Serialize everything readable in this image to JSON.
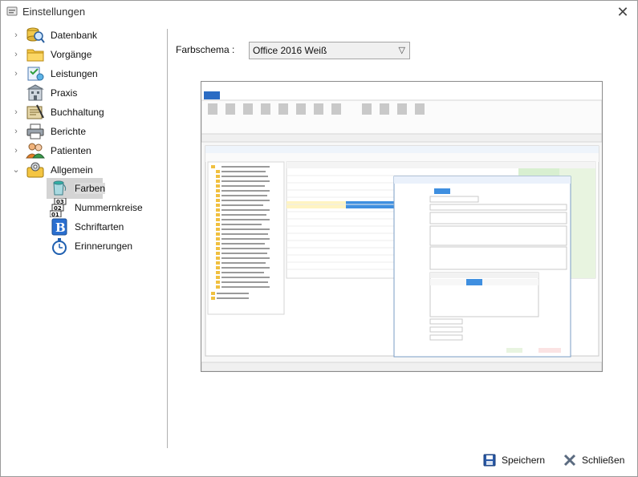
{
  "window": {
    "title": "Einstellungen",
    "close_label": "✕"
  },
  "nav": {
    "items": [
      {
        "label": "Datenbank",
        "icon": "database-search-icon"
      },
      {
        "label": "Vorgänge",
        "icon": "folder-icon"
      },
      {
        "label": "Leistungen",
        "icon": "services-icon"
      },
      {
        "label": "Praxis",
        "icon": "building-icon"
      },
      {
        "label": "Buchhaltung",
        "icon": "accounting-icon"
      },
      {
        "label": "Berichte",
        "icon": "printer-icon"
      },
      {
        "label": "Patienten",
        "icon": "patients-icon"
      },
      {
        "label": "Allgemein",
        "icon": "general-settings-icon"
      }
    ],
    "subitems": [
      {
        "label": "Farben",
        "icon": "paint-bucket-icon"
      },
      {
        "label": "Nummernkreise",
        "icon": "number-ranges-icon"
      },
      {
        "label": "Schriftarten",
        "icon": "font-b-icon"
      },
      {
        "label": "Erinnerungen",
        "icon": "stopwatch-icon"
      }
    ]
  },
  "settings": {
    "farbschema_label": "Farbschema :",
    "farbschema_value": "Office 2016 Weiß"
  },
  "footer": {
    "save_label": "Speichern",
    "close_label": "Schließen"
  }
}
